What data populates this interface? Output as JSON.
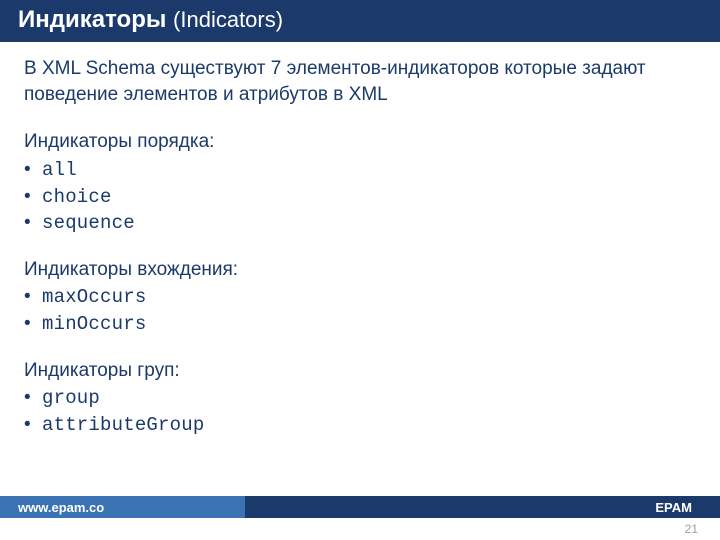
{
  "title": {
    "main": "Индикаторы",
    "sub": "(Indicators)"
  },
  "intro": "В XML Schema существуют 7 элементов-индикаторов которые задают поведение элементов и атрибутов в XML",
  "sections": [
    {
      "heading": "Индикаторы порядка:",
      "items": [
        "all",
        "choice",
        "sequence"
      ]
    },
    {
      "heading": "Индикаторы вхождения:",
      "items": [
        "maxOccurs",
        "minOccurs"
      ]
    },
    {
      "heading": "Индикаторы груп:",
      "items": [
        "group",
        "attributeGroup"
      ]
    }
  ],
  "footer": {
    "left": "www.epam.co",
    "right": "EPAM"
  },
  "page": "21",
  "bullet_char": "•"
}
